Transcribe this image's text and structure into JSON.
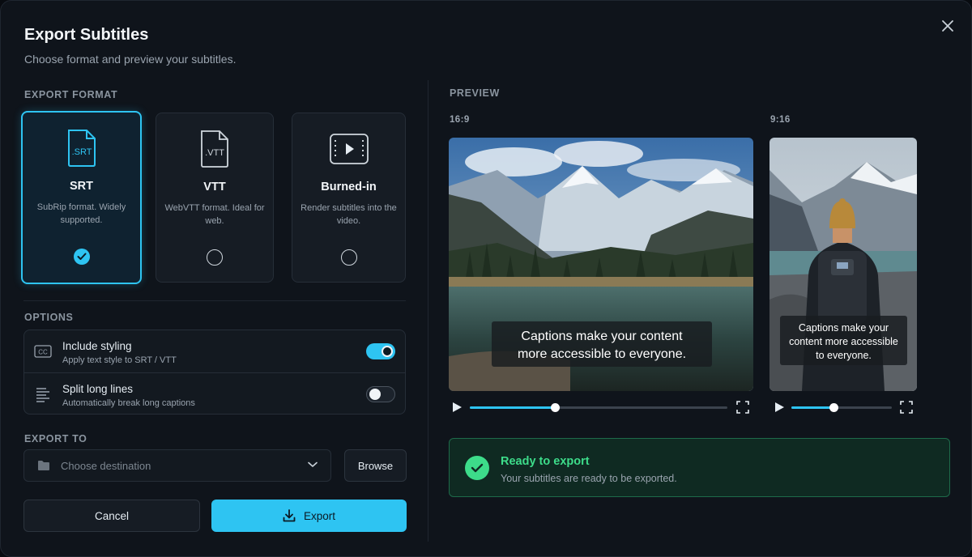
{
  "dialog": {
    "title": "Export Subtitles",
    "subtitle": "Choose format and preview your subtitles."
  },
  "format": {
    "section_label": "EXPORT FORMAT",
    "options": [
      {
        "icon": "srt-file-icon",
        "icon_text": ".SRT",
        "name": "SRT",
        "description": "SubRip format. Widely supported.",
        "selected": true
      },
      {
        "icon": "vtt-file-icon",
        "icon_text": ".VTT",
        "name": "VTT",
        "description": "WebVTT format. Ideal for web.",
        "selected": false
      },
      {
        "icon": "video-play-icon",
        "icon_text": "",
        "name": "Burned-in",
        "description": "Render subtitles into the video.",
        "selected": false
      }
    ]
  },
  "options": {
    "section_label": "OPTIONS",
    "items": [
      {
        "icon": "cc-icon",
        "icon_text": "CC",
        "title": "Include styling",
        "subtitle": "Apply text style to SRT / VTT",
        "enabled": true
      },
      {
        "icon": "text-lines-icon",
        "title": "Split long lines",
        "subtitle": "Automatically break long captions",
        "enabled": false
      }
    ]
  },
  "export_to": {
    "section_label": "EXPORT TO",
    "placeholder": "Choose destination",
    "browse_label": "Browse"
  },
  "actions": {
    "cancel_label": "Cancel",
    "export_label": "Export"
  },
  "preview": {
    "section_label": "PREVIEW",
    "landscape": {
      "ratio_label": "16:9",
      "caption_lines": [
        "Captions make your content",
        "more accessible to everyone."
      ],
      "progress": 0.33
    },
    "portrait": {
      "ratio_label": "9:16",
      "caption_lines": [
        "Captions make your",
        "content more accessible",
        "to everyone."
      ],
      "progress": 0.42
    }
  },
  "status": {
    "title": "Ready to export",
    "message": "Your subtitles are ready to be exported."
  },
  "colors": {
    "accent": "#2ec4f2",
    "success": "#3ddc8a",
    "background": "#0f141b"
  }
}
